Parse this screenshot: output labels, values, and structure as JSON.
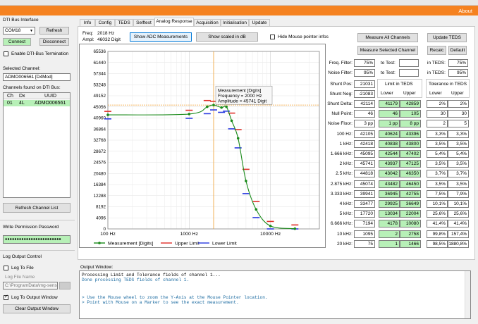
{
  "header": {
    "about": "About"
  },
  "left": {
    "bus_interface_label": "DTI Bus Interface",
    "com_port": "COM18",
    "refresh": "Refresh",
    "connect": "Connect",
    "disconnect": "Disconnect",
    "enable_termination": "Enable DTI-Bus Termination",
    "selected_channel_label": "Selected Channel:",
    "selected_channel_value": "ADMO006561    [D4Mod]",
    "channels_found_label": "Channels found on DTI Bus:",
    "table_headers": [
      "Ch",
      "Dx",
      "UUID"
    ],
    "table_rows": [
      [
        "01",
        "4L",
        "ADMO006561"
      ]
    ],
    "refresh_channel_list": "Refresh Channel List",
    "write_permission_label": "Write Permission Password",
    "password_mask": "●●●●●●●●●●●●●●●●●●●●●●●●",
    "log_output_label": "Log Output Control",
    "log_to_file": "Log To File",
    "log_file_name_label": "Log File Name",
    "log_file_path": "C:\\ProgramData\\mg-sensor",
    "log_to_output_window": "Log To Output Window",
    "clear_output_window": "Clear Output Window"
  },
  "tabs": [
    {
      "label": "Info"
    },
    {
      "label": "Config"
    },
    {
      "label": "TEDS"
    },
    {
      "label": "Selftest"
    },
    {
      "label": "Analog Response",
      "active": true
    },
    {
      "label": "Acquisition"
    },
    {
      "label": "Initialisation"
    },
    {
      "label": "Update"
    }
  ],
  "center": {
    "freq_label": "Freq:",
    "freq_value": "2018 Hz",
    "ampl_label": "Ampl:",
    "ampl_value": "46032 Digit",
    "show_adc": "Show ADC Measurements",
    "show_db": "Show scaled in dB",
    "hide_mouse": "Hide Mouse pointer infos",
    "tooltip_lines": [
      "Measurement [Digits]",
      "Frequency = 2000 Hz",
      "Amplitude = 45741 Digit"
    ]
  },
  "chart_data": {
    "type": "line",
    "x_scale": "log",
    "xlim": [
      100,
      40000
    ],
    "ylim": [
      0,
      65536
    ],
    "y_ticks": [
      0,
      4096,
      8192,
      12288,
      16384,
      20480,
      24576,
      28672,
      32768,
      36864,
      40960,
      45056,
      49152,
      53248,
      57344,
      61440,
      65536
    ],
    "x_ticks": [
      {
        "value": 100,
        "label": "100 Hz"
      },
      {
        "value": 1000,
        "label": "1000 Hz"
      },
      {
        "value": 10000,
        "label": "10000 Hz"
      }
    ],
    "series": [
      {
        "name": "Measurement [Digits]",
        "color": "#1a8a1a",
        "x": [
          100,
          1000,
          1666,
          2000,
          2500,
          2875,
          3333,
          4000,
          5000,
          6666,
          10000,
          20000
        ],
        "y": [
          42105,
          42418,
          45095,
          45741,
          44818,
          45074,
          39941,
          33477,
          17720,
          7194,
          1095,
          75
        ]
      },
      {
        "name": "Upper Limit",
        "color": "#e0302a",
        "x": [
          100,
          1000,
          1666,
          2000,
          2500,
          2875,
          3333,
          4000,
          5000,
          6666,
          10000,
          20000
        ],
        "y": [
          43396,
          43800,
          47402,
          47125,
          46350,
          46450,
          42755,
          36649,
          22004,
          10080,
          2758,
          1466
        ]
      },
      {
        "name": "Lower Limit",
        "color": "#2a3ae0",
        "x": [
          100,
          1000,
          1666,
          2000,
          2500,
          2875,
          3333,
          4000,
          5000,
          6666,
          10000,
          20000
        ],
        "y": [
          40624,
          40838,
          42544,
          43937,
          43042,
          43482,
          36945,
          29925,
          13034,
          4178,
          2,
          1
        ]
      }
    ],
    "markers": [
      {
        "orientation": "vertical",
        "x": 2000
      },
      {
        "orientation": "horizontal",
        "y": 45741
      }
    ],
    "grid": true,
    "legend": "bottom"
  },
  "right": {
    "measure_all": "Measure All Channels",
    "update_teds": "Update TEDS",
    "measure_selected": "Measure Selected Channel",
    "recalc": "Recalc",
    "default": "Default",
    "freq_filter_label": "Freq. Filter:",
    "freq_filter": "75%",
    "freq_to_test_label": "to Test:",
    "freq_to_test": "",
    "freq_in_teds_label": "in TEDS:",
    "freq_in_teds": "75%",
    "noise_filter_label": "Noise Filter:",
    "noise_filter": "95%",
    "noise_to_test_label": "to Test:",
    "noise_to_test": "",
    "noise_in_teds_label": "in TEDS:",
    "noise_in_teds": "95%",
    "shunt_pos_label": "Shunt Pos:",
    "shunt_pos": "21031",
    "shunt_neg_label": "Shunt Neg:",
    "shunt_neg": "-21083",
    "limit_in_teds": "Limit in TEDS",
    "tolerance_in_teds": "Tolerance in TEDS",
    "lower": "Lower",
    "upper": "Upper",
    "tol_lower": "Lower",
    "tol_upper": "Upper",
    "rows": [
      {
        "label": "Shunt Delta:",
        "value": "42114",
        "lower": "41179",
        "upper": "42859",
        "tol_lower": "2%",
        "tol_upper": "2%"
      },
      {
        "label": "Null Point:",
        "value": "46",
        "lower": "46",
        "upper": "105",
        "tol_lower": "30",
        "tol_upper": "30"
      },
      {
        "label": "Noise Floor:",
        "value": "3 pp",
        "lower": "1 pp",
        "upper": "8 pp",
        "tol_lower": "2",
        "tol_upper": "5"
      },
      {
        "label": "100 Hz:",
        "value": "42105",
        "lower": "40624",
        "upper": "43396",
        "tol_lower": "3,3%",
        "tol_upper": "3,3%"
      },
      {
        "label": "1 kHz:",
        "value": "42418",
        "lower": "40838",
        "upper": "43800",
        "tol_lower": "3,5%",
        "tol_upper": "3,5%"
      },
      {
        "label": "1.666 kHz:",
        "value": "45095",
        "lower": "42544",
        "upper": "47402",
        "tol_lower": "5,4%",
        "tol_upper": "5,4%"
      },
      {
        "label": "2 kHz:",
        "value": "45741",
        "lower": "43937",
        "upper": "47125",
        "tol_lower": "3,5%",
        "tol_upper": "3,5%"
      },
      {
        "label": "2.5 kHz:",
        "value": "44818",
        "lower": "43042",
        "upper": "46350",
        "tol_lower": "3,7%",
        "tol_upper": "3,7%"
      },
      {
        "label": "2.875 kHz:",
        "value": "45074",
        "lower": "43482",
        "upper": "46450",
        "tol_lower": "3,5%",
        "tol_upper": "3,5%"
      },
      {
        "label": "3.333 kHz:",
        "value": "39941",
        "lower": "36945",
        "upper": "42755",
        "tol_lower": "7,5%",
        "tol_upper": "7,9%"
      },
      {
        "label": "4 kHz:",
        "value": "33477",
        "lower": "29925",
        "upper": "36649",
        "tol_lower": "10,1%",
        "tol_upper": "10,1%"
      },
      {
        "label": "5 kHz:",
        "value": "17720",
        "lower": "13034",
        "upper": "22004",
        "tol_lower": "25,6%",
        "tol_upper": "25,6%"
      },
      {
        "label": "6.666 kHz:",
        "value": "7194",
        "lower": "4178",
        "upper": "10080",
        "tol_lower": "41,4%",
        "tol_upper": "41,4%"
      },
      {
        "label": "10 kHz:",
        "value": "1095",
        "lower": "2",
        "upper": "2758",
        "tol_lower": "99,8%",
        "tol_upper": "157,4%"
      },
      {
        "label": "20 kHz:",
        "value": "75",
        "lower": "1",
        "upper": "1466",
        "tol_lower": "98,5%",
        "tol_upper": "1880,8%"
      }
    ]
  },
  "output": {
    "title": "Output Window:",
    "lines": [
      "Processing Limit and Tolerance fields of channel 1...",
      "Done processing TEDS fields of channel 1.",
      "",
      "",
      "> Use the Mouse wheel to zoom the Y-Axis at the Mouse Pointer location.",
      "> Point with Mouse on a Marker to see the exact measurement."
    ]
  },
  "colors": {
    "accent": "#f58220",
    "pass_green": "#b7f0b7",
    "selected_row": "#b7f0b7"
  }
}
